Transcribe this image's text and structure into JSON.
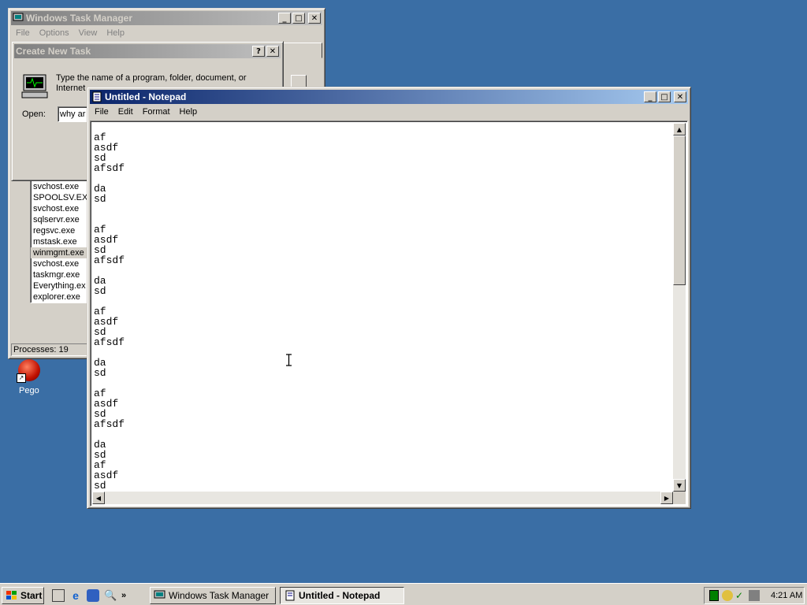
{
  "desktop": {
    "icon_label": "Pego"
  },
  "task_manager": {
    "title": "Windows Task Manager",
    "menu": [
      "File",
      "Options",
      "View",
      "Help"
    ],
    "processes": [
      "svchost.exe",
      "SPOOLSV.EXE",
      "svchost.exe",
      "sqlservr.exe",
      "regsvc.exe",
      "mstask.exe",
      "winmgmt.exe",
      "svchost.exe",
      "taskmgr.exe",
      "Everything.ex",
      "explorer.exe"
    ],
    "status": "Processes: 19"
  },
  "create_task": {
    "title": "Create New Task",
    "help_button": "?",
    "close_button": "✕",
    "description_line1": "Type the name of a program, folder, document, or",
    "description_line2": "Internet",
    "open_label": "Open:",
    "open_value": "why ar"
  },
  "notepad": {
    "title": "Untitled - Notepad",
    "menu": [
      "File",
      "Edit",
      "Format",
      "Help"
    ],
    "text": "af\nasdf\nsd\nafsdf\n\nda\nsd\n\n\naf\nasdf\nsd\nafsdf\n\nda\nsd\n\naf\nasdf\nsd\nafsdf\n\nda\nsd\n\naf\nasdf\nsd\nafsdf\n\nda\nsd\naf\nasdf\nsd"
  },
  "taskbar": {
    "start_label": "Start",
    "buttons": [
      {
        "label": "Windows Task Manager"
      },
      {
        "label": "Untitled - Notepad"
      }
    ],
    "clock": "4:21 AM"
  }
}
